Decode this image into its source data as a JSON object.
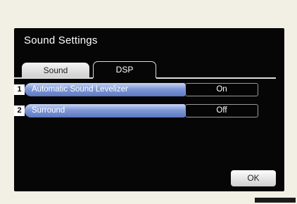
{
  "window": {
    "title": "Sound Settings"
  },
  "tabs": [
    {
      "label": "Sound",
      "active": false
    },
    {
      "label": "DSP",
      "active": true
    }
  ],
  "settings": [
    {
      "number": "1",
      "label": "Automatic Sound Levelizer",
      "value": "On"
    },
    {
      "number": "2",
      "label": "Surround",
      "value": "Off"
    }
  ],
  "buttons": {
    "ok_label": "OK"
  },
  "colors": {
    "screen_bg": "#060606",
    "row_highlight": "#7f98d6",
    "page_bg": "#f2f0e4"
  }
}
